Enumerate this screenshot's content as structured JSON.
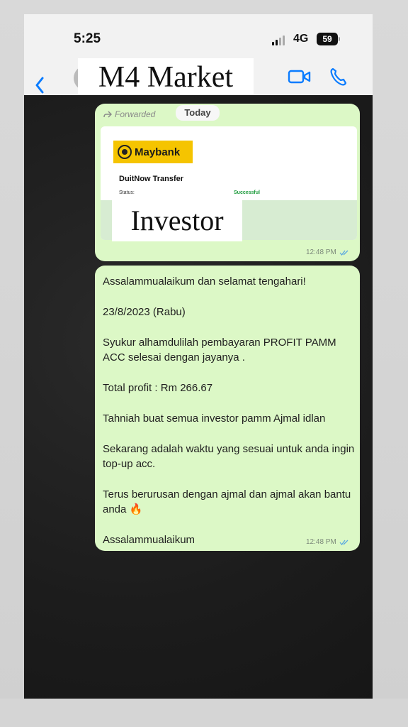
{
  "status_bar": {
    "time": "5:25",
    "network": "4G",
    "battery": "59"
  },
  "header": {
    "contact_name": "M4 Market",
    "back_icon": "chevron-left-icon",
    "video_icon": "video-camera-icon",
    "call_icon": "phone-icon"
  },
  "chat": {
    "date_label": "Today",
    "messages": [
      {
        "forwarded_label": "Forwarded",
        "receipt": {
          "bank": "Maybank",
          "title": "DuitNow Transfer",
          "status_label": "Status:",
          "status_value": "Successful"
        },
        "overlay_label": "Investor",
        "time": "12:48 PM"
      },
      {
        "lines": [
          "Assalammualaikum dan selamat tengahari!",
          "23/8/2023 (Rabu)",
          "Syukur alhamdulilah pembayaran PROFIT PAMM ACC selesai dengan jayanya .",
          "Total profit : Rm 266.67",
          "Tahniah buat semua investor pamm Ajmal idlan",
          "Sekarang adalah waktu yang sesuai untuk anda ingin top-up acc.",
          "Terus berurusan dengan ajmal dan ajmal akan bantu anda 🔥",
          "Assalammualaikum"
        ],
        "time": "12:48 PM"
      }
    ]
  },
  "colors": {
    "bubble": "#dcf8c6",
    "accent": "#0a7cff",
    "maybank_yellow": "#f5c400"
  }
}
